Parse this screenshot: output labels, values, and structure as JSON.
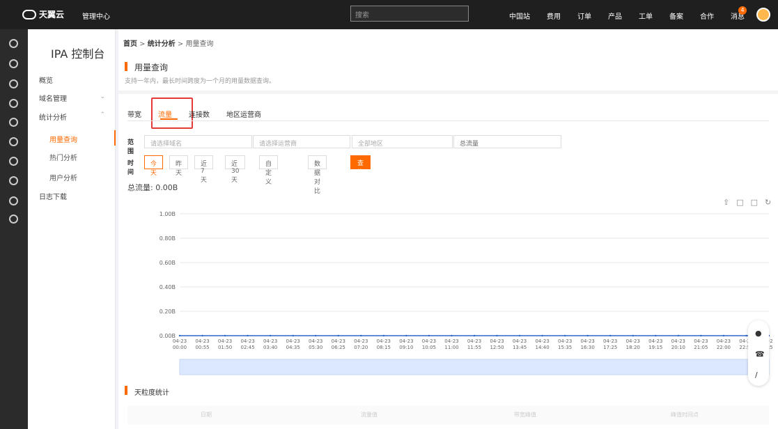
{
  "header": {
    "brand": "天翼云",
    "console": "管理中心",
    "search_placeholder": "搜索",
    "nav": [
      "中国站",
      "费用",
      "订单",
      "产品",
      "工单",
      "备案",
      "合作",
      "消息"
    ],
    "message_count": "4"
  },
  "sidebar": {
    "title": "IPA 控制台",
    "items": [
      {
        "label": "概览"
      },
      {
        "label": "域名管理"
      },
      {
        "label": "统计分析"
      },
      {
        "label": "用量查询"
      },
      {
        "label": "热门分析"
      },
      {
        "label": "用户分析"
      },
      {
        "label": "日志下载"
      }
    ]
  },
  "breadcrumb": [
    "首页",
    "统计分析",
    "用量查询"
  ],
  "page": {
    "title": "用量查询",
    "description": "支持一年内，最长时间跨度为一个月的用量数据查询。"
  },
  "tabs": [
    "带宽",
    "流量",
    "连接数",
    "地区运营商"
  ],
  "filters": {
    "range_label": "范围",
    "domain_placeholder": "请选择域名",
    "isp_placeholder": "请选择运营商",
    "region": "全部地区",
    "metric": "总流量",
    "time_label": "时间",
    "time_buttons": [
      "今天",
      "昨天",
      "近7天",
      "近30天",
      "自定义"
    ],
    "compare": "数据对比",
    "query": "查询"
  },
  "summary": {
    "total_label": "总流量:",
    "total_value": "0.00B"
  },
  "chart_data": {
    "type": "line",
    "yticks": [
      "1.00B",
      "0.80B",
      "0.60B",
      "0.40B",
      "0.20B",
      "0.00B"
    ],
    "x": [
      "04-23 00:00",
      "04-23 00:55",
      "04-23 01:50",
      "04-23 02:45",
      "04-23 03:40",
      "04-23 04:35",
      "04-23 05:30",
      "04-23 06:25",
      "04-23 07:20",
      "04-23 08:15",
      "04-23 09:10",
      "04-23 10:05",
      "04-23 11:00",
      "04-23 11:55",
      "04-23 12:50",
      "04-23 13:45",
      "04-23 14:40",
      "04-23 15:35",
      "04-23 16:30",
      "04-23 17:25",
      "04-23 18:20",
      "04-23 19:15",
      "04-23 20:10",
      "04-23 21:05",
      "04-23 22:00",
      "04-23 22:55",
      "04-23 23:50"
    ],
    "series": [
      {
        "values": [
          0,
          0,
          0,
          0,
          0,
          0,
          0,
          0,
          0,
          0,
          0,
          0,
          0,
          0,
          0,
          0,
          0,
          0,
          0,
          0,
          0,
          0,
          0,
          0,
          0,
          0,
          0
        ]
      }
    ],
    "ylim": [
      0,
      1
    ],
    "grid": true
  },
  "bottom": {
    "title": "天粒度统计",
    "headers": [
      "日期",
      "流量值",
      "带宽峰值",
      "峰值时间点"
    ]
  }
}
